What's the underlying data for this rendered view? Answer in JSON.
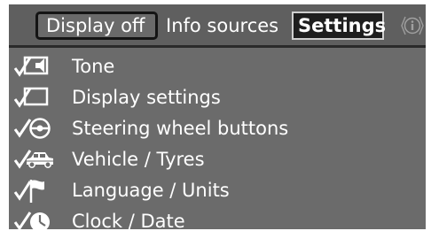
{
  "tabs": {
    "display_off": "Display off",
    "info_sources": "Info sources",
    "settings": "Settings"
  },
  "menu": {
    "items": [
      {
        "label": "Tone",
        "icon": "tone-icon"
      },
      {
        "label": "Display settings",
        "icon": "display-icon"
      },
      {
        "label": "Steering wheel buttons",
        "icon": "steering-wheel-icon"
      },
      {
        "label": "Vehicle / Tyres",
        "icon": "car-icon"
      },
      {
        "label": "Language / Units",
        "icon": "flag-icon"
      },
      {
        "label": "Clock / Date",
        "icon": "clock-icon"
      }
    ]
  },
  "colors": {
    "screen_bg": "#6b6b6b",
    "text": "#ffffff",
    "selected_tab_bg": "#1e1e1e"
  }
}
